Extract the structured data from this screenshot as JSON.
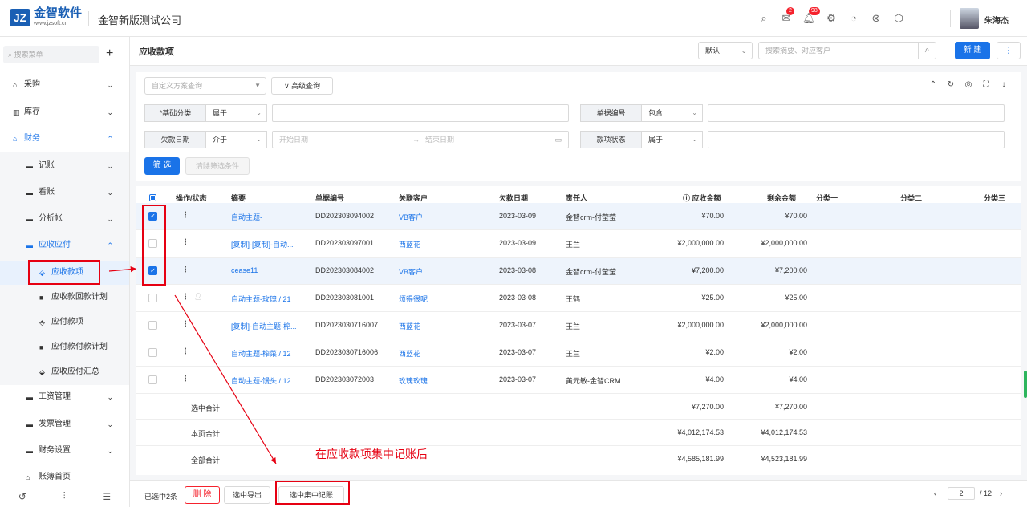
{
  "header": {
    "logo_mark": "JZ",
    "logo_name": "金智软件",
    "logo_url": "www.jzsoft.cn",
    "company": "金智新版测试公司",
    "icons": [
      "search-icon",
      "mail-icon",
      "bell-icon",
      "gear-icon",
      "chart-icon",
      "share-icon",
      "box-icon"
    ],
    "mail_badge": "2",
    "bell_badge": "98",
    "username": "朱海杰"
  },
  "sidebar": {
    "search_placeholder": "搜索菜单",
    "items": [
      {
        "label": "采购"
      },
      {
        "label": "库存"
      },
      {
        "label": "财务"
      },
      {
        "label": "记账"
      },
      {
        "label": "看账"
      },
      {
        "label": "分析帐"
      },
      {
        "label": "应收应付"
      },
      {
        "label": "应收款项"
      },
      {
        "label": "应收款回款计划"
      },
      {
        "label": "应付款项"
      },
      {
        "label": "应付款付款计划"
      },
      {
        "label": "应收应付汇总"
      },
      {
        "label": "工资管理"
      },
      {
        "label": "发票管理"
      },
      {
        "label": "财务设置"
      },
      {
        "label": "账簿首页"
      }
    ]
  },
  "page": {
    "title": "应收款项",
    "sort_select": "默认",
    "search_placeholder": "搜索摘要、对应客户",
    "new_label": "新 建",
    "more_label": "⋮"
  },
  "filters": {
    "scheme_placeholder": "自定义方案查询",
    "advanced_label": "高级查询",
    "rows": [
      {
        "label": "*基础分类",
        "op": "属于"
      },
      {
        "label": "单据编号",
        "op": "包含"
      },
      {
        "label": "欠款日期",
        "op": "介于",
        "start_placeholder": "开始日期",
        "end_placeholder": "结束日期"
      },
      {
        "label": "款项状态",
        "op": "属于"
      }
    ],
    "filter_label": "筛 选",
    "clear_label": "清除筛选条件"
  },
  "table": {
    "columns": [
      "操作/状态",
      "摘要",
      "单据编号",
      "关联客户",
      "欠款日期",
      "责任人",
      "应收金额",
      "剩余金额",
      "分类一",
      "分类二",
      "分类三"
    ],
    "rows": [
      {
        "checked": true,
        "summary": "自动主题-",
        "doc_no": "DD202303094002",
        "customer": "VB客户",
        "date": "2023-03-09",
        "owner": "金智crm-付莹莹",
        "receivable": "¥70.00",
        "remaining": "¥70.00"
      },
      {
        "checked": false,
        "summary": "[复制]-[复制]-自动...",
        "doc_no": "DD202303097001",
        "customer": "西蓝花",
        "date": "2023-03-09",
        "owner": "王兰",
        "receivable": "¥2,000,000.00",
        "remaining": "¥2,000,000.00"
      },
      {
        "checked": true,
        "summary": "cease11",
        "doc_no": "DD202303084002",
        "customer": "VB客户",
        "date": "2023-03-08",
        "owner": "金智crm-付莹莹",
        "receivable": "¥7,200.00",
        "remaining": "¥7,200.00"
      },
      {
        "checked": false,
        "summary": "自动主题-玫瑰 / 21",
        "doc_no": "DD202303081001",
        "customer": "烦得很呢",
        "date": "2023-03-08",
        "owner": "王鹤",
        "receivable": "¥25.00",
        "remaining": "¥25.00"
      },
      {
        "checked": false,
        "summary": "[复制]-自动主题-榨...",
        "doc_no": "DD2023030716007",
        "customer": "西蓝花",
        "date": "2023-03-07",
        "owner": "王兰",
        "receivable": "¥2,000,000.00",
        "remaining": "¥2,000,000.00"
      },
      {
        "checked": false,
        "summary": "自动主题-榨菜 / 12",
        "doc_no": "DD2023030716006",
        "customer": "西蓝花",
        "date": "2023-03-07",
        "owner": "王兰",
        "receivable": "¥2.00",
        "remaining": "¥2.00"
      },
      {
        "checked": false,
        "summary": "自动主题-馒头 / 12...",
        "doc_no": "DD202303072003",
        "customer": "玫瑰玫瑰",
        "date": "2023-03-07",
        "owner": "黄元敏-金智CRM",
        "receivable": "¥4.00",
        "remaining": "¥4.00"
      }
    ],
    "totals": [
      {
        "label": "选中合计",
        "receivable": "¥7,270.00",
        "remaining": "¥7,270.00"
      },
      {
        "label": "本页合计",
        "receivable": "¥4,012,174.53",
        "remaining": "¥4,012,174.53"
      },
      {
        "label": "全部合计",
        "receivable": "¥4,585,181.99",
        "remaining": "¥4,523,181.99"
      }
    ]
  },
  "footer": {
    "selected_count": "已选中2条",
    "delete_label": "删 除",
    "export_label": "选中导出",
    "post_label": "选中集中记账",
    "page_current": "2",
    "page_total": "/ 12"
  },
  "annotation": {
    "text": "在应收款项集中记账后",
    "color": "#e60012"
  }
}
